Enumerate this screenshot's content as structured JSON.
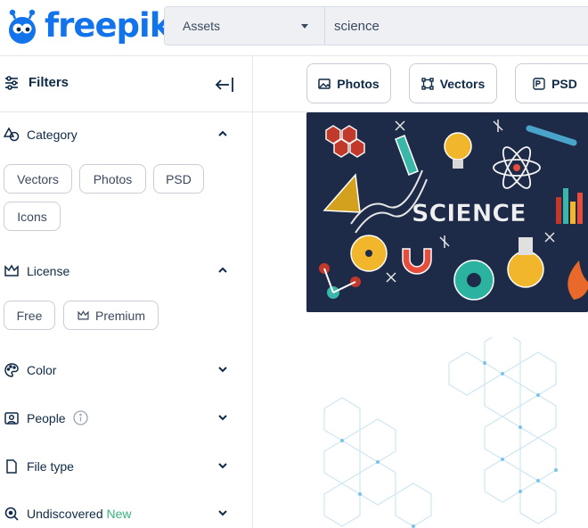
{
  "header": {
    "logo_text": "freepik",
    "asset_select": "Assets",
    "search_value": "science"
  },
  "sidebar": {
    "title": "Filters",
    "category": {
      "title": "Category",
      "chips": [
        "Vectors",
        "Photos",
        "PSD",
        "Icons"
      ]
    },
    "license": {
      "title": "License",
      "chips": [
        "Free",
        "Premium"
      ]
    },
    "color": {
      "title": "Color"
    },
    "people": {
      "title": "People"
    },
    "file_type": {
      "title": "File type"
    },
    "undiscovered": {
      "title": "Undiscovered",
      "badge": "New"
    }
  },
  "main": {
    "type_buttons": [
      "Photos",
      "Vectors",
      "PSD"
    ],
    "thumb1_text": "SCIENCE"
  },
  "colors": {
    "brand": "#1273eb",
    "text": "#0e2a47",
    "new": "#36b37e"
  }
}
